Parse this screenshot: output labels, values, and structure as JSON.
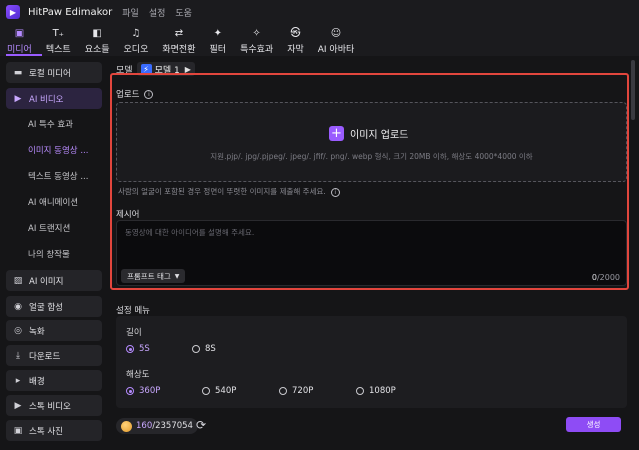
{
  "app": {
    "title": "HitPaw Edimakor",
    "menu": [
      "파일",
      "설정",
      "도움"
    ],
    "logo_glyph": "▶"
  },
  "toolbar": {
    "tabs": [
      {
        "label": "미디어",
        "icon": "media-icon",
        "glyph": "▣",
        "active": true
      },
      {
        "label": "텍스트",
        "icon": "text-icon",
        "glyph": "T₊",
        "active": false
      },
      {
        "label": "요소들",
        "icon": "elements-icon",
        "glyph": "◧",
        "active": false
      },
      {
        "label": "오디오",
        "icon": "audio-icon",
        "glyph": "♫",
        "active": false
      },
      {
        "label": "화면전환",
        "icon": "transition-icon",
        "glyph": "⇄",
        "active": false
      },
      {
        "label": "필터",
        "icon": "filter-icon",
        "glyph": "✦",
        "active": false
      },
      {
        "label": "특수효과",
        "icon": "effects-icon",
        "glyph": "✧",
        "active": false
      },
      {
        "label": "자막",
        "icon": "subtitle-icon",
        "glyph": "㉿",
        "active": false
      },
      {
        "label": "AI 아바타",
        "icon": "ai-avatar-icon",
        "glyph": "☺",
        "active": false
      }
    ]
  },
  "sidebar": {
    "items": [
      {
        "label": "로컬 미디어",
        "icon": "folder-icon",
        "glyph": "▬",
        "active": false
      },
      {
        "label": "AI 비디오",
        "icon": "ai-video-icon",
        "glyph": "▶",
        "active": true
      },
      {
        "label": "AI 이미지",
        "icon": "ai-image-icon",
        "glyph": "▨",
        "active": false
      },
      {
        "label": "얼굴 합성",
        "icon": "face-swap-icon",
        "glyph": "◉",
        "active": false
      },
      {
        "label": "녹화",
        "icon": "record-icon",
        "glyph": "◎",
        "active": false
      },
      {
        "label": "다운로드",
        "icon": "download-icon",
        "glyph": "⤓",
        "active": false
      },
      {
        "label": "배경",
        "icon": "background-icon",
        "glyph": "▸",
        "active": false
      },
      {
        "label": "스톡 비디오",
        "icon": "stock-video-icon",
        "glyph": "▶",
        "active": false
      },
      {
        "label": "스톡 사진",
        "icon": "stock-photo-icon",
        "glyph": "▣",
        "active": false
      }
    ],
    "sub_items": [
      {
        "label": "AI 특수 효과",
        "active": false
      },
      {
        "label": "이미지 동영상 ...",
        "active": true
      },
      {
        "label": "텍스트 동영상 ...",
        "active": false
      },
      {
        "label": "AI 애니메이션",
        "active": false
      },
      {
        "label": "AI 트랜지션",
        "active": false
      },
      {
        "label": "나의 창작물",
        "active": false
      }
    ]
  },
  "model": {
    "label": "모델",
    "value": "모델 1",
    "badge_glyph": "⚡"
  },
  "upload": {
    "section_label": "업로드",
    "button_label": "이미지 업로드",
    "hint": "지원.pjp/. jpg/.pjpeg/. jpeg/. jfif/. png/. webp 형식, 크기 20MB 이하, 해상도 4000*4000 이하",
    "notice": "사람의 얼굴이 포함된 경우 정면이 뚜렷한 이미지를 제출해 주세요."
  },
  "prompt": {
    "section_label": "제시어",
    "placeholder": "동영상에 대한 아이디어를 설명해 주세요.",
    "tag_button": "프롬프트 태그",
    "count": "0",
    "max": "/2000"
  },
  "settings": {
    "title": "설정 메뉴",
    "length_label": "길이",
    "length_options": [
      {
        "label": "5S",
        "selected": true
      },
      {
        "label": "8S",
        "selected": false
      }
    ],
    "resolution_label": "해상도",
    "resolution_options": [
      {
        "label": "360P",
        "selected": true
      },
      {
        "label": "540P",
        "selected": false
      },
      {
        "label": "720P",
        "selected": false
      },
      {
        "label": "1080P",
        "selected": false
      }
    ]
  },
  "footer": {
    "credits_used": "160",
    "credits_total": "/2357054",
    "generate_label": "생성"
  },
  "colors": {
    "accent": "#9a5cff",
    "highlight_frame": "#e2463d",
    "background": "#151517"
  }
}
